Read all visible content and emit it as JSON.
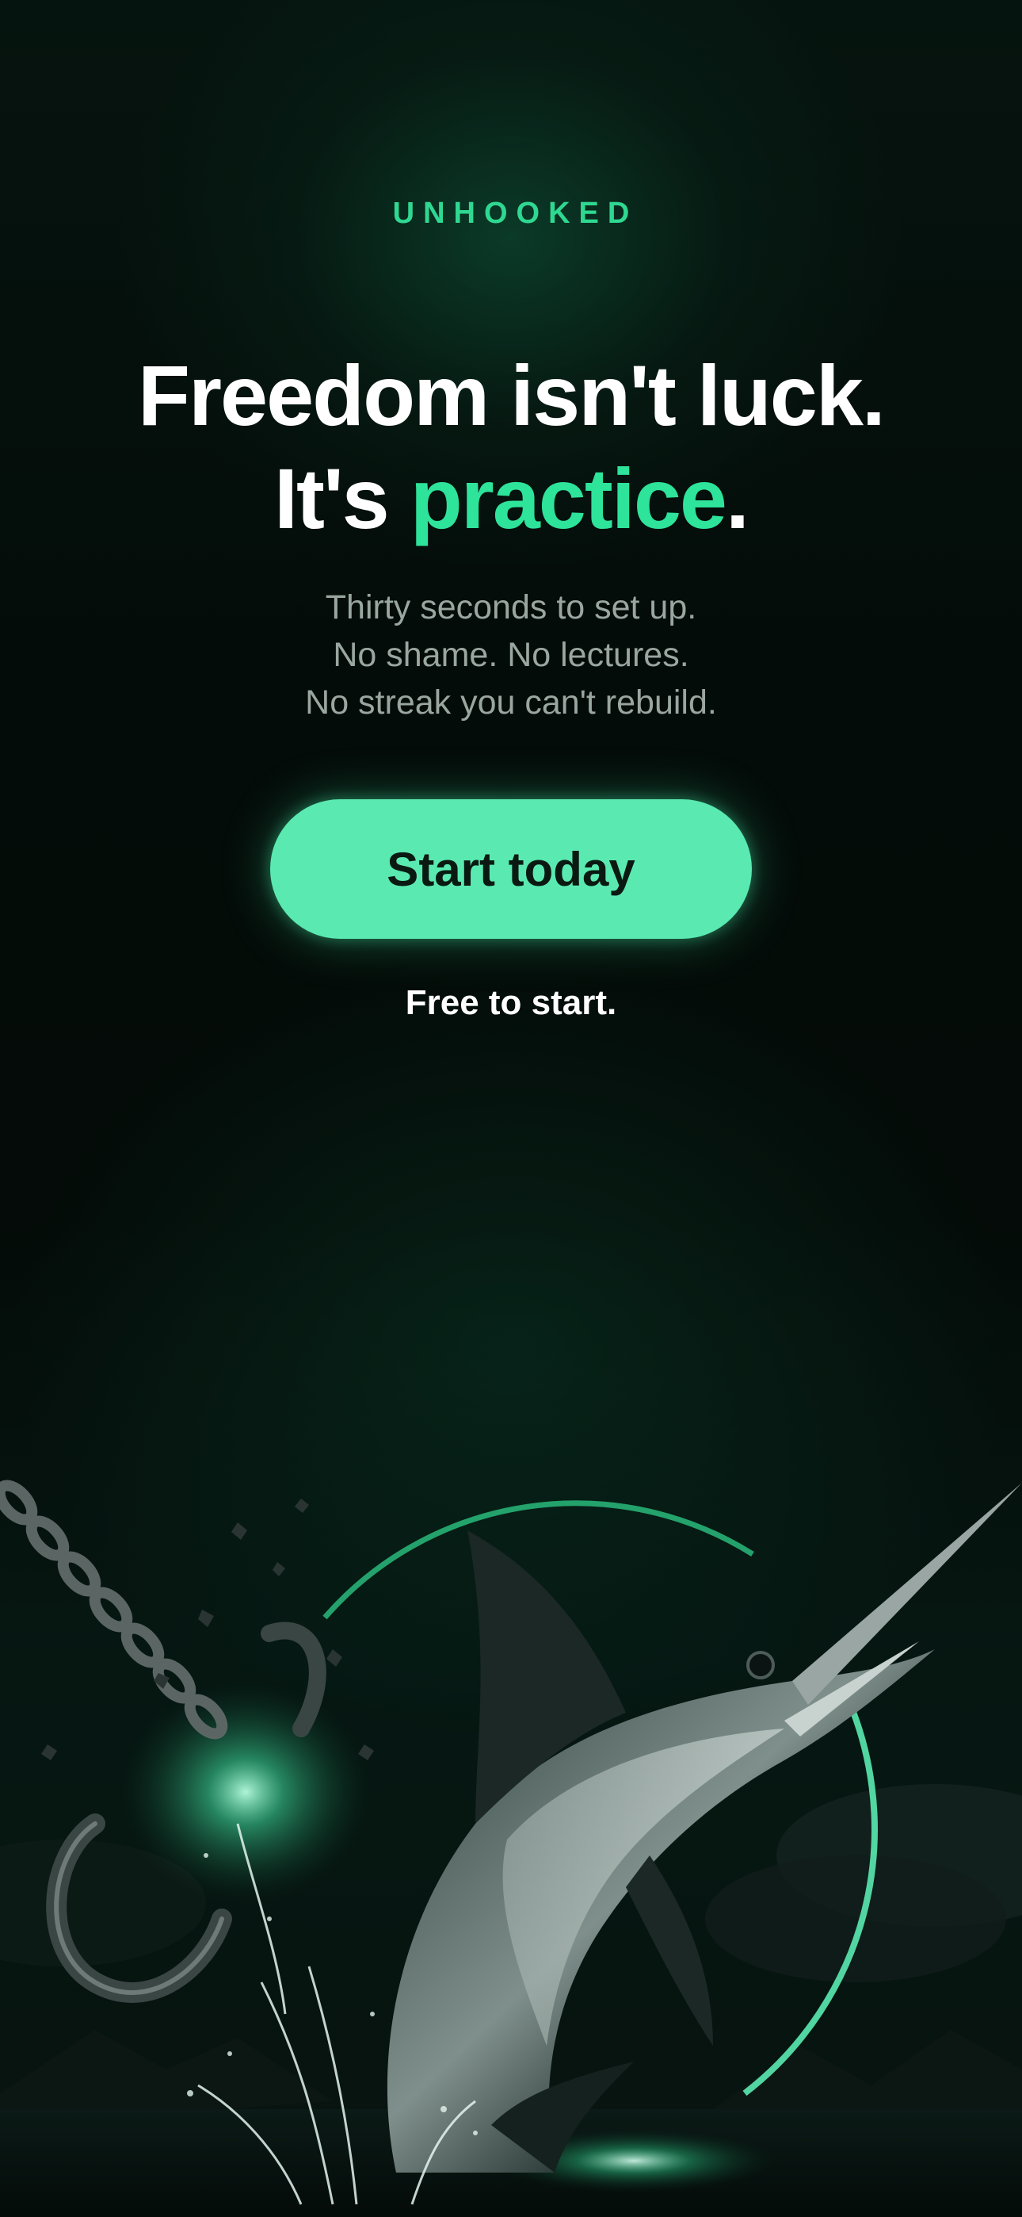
{
  "brand": {
    "name": "UNHOOKED"
  },
  "headline": {
    "line1": "Freedom isn't luck.",
    "line2_prefix": "It's ",
    "line2_accent": "practice",
    "line2_suffix": "."
  },
  "subtext": {
    "lines": [
      "Thirty seconds to set up.",
      "No shame. No lectures.",
      "No streak you can't rebuild."
    ]
  },
  "cta": {
    "label": "Start today"
  },
  "footnote": {
    "text": "Free to start."
  },
  "colors": {
    "accent": "#2ee39a",
    "button": "#5aeab1",
    "background": "#040b08",
    "muted_text": "#9aa6a0"
  },
  "hero": {
    "icons": [
      "marlin-illustration",
      "broken-chain-icon",
      "broken-hook-icon",
      "glow-ring"
    ]
  }
}
